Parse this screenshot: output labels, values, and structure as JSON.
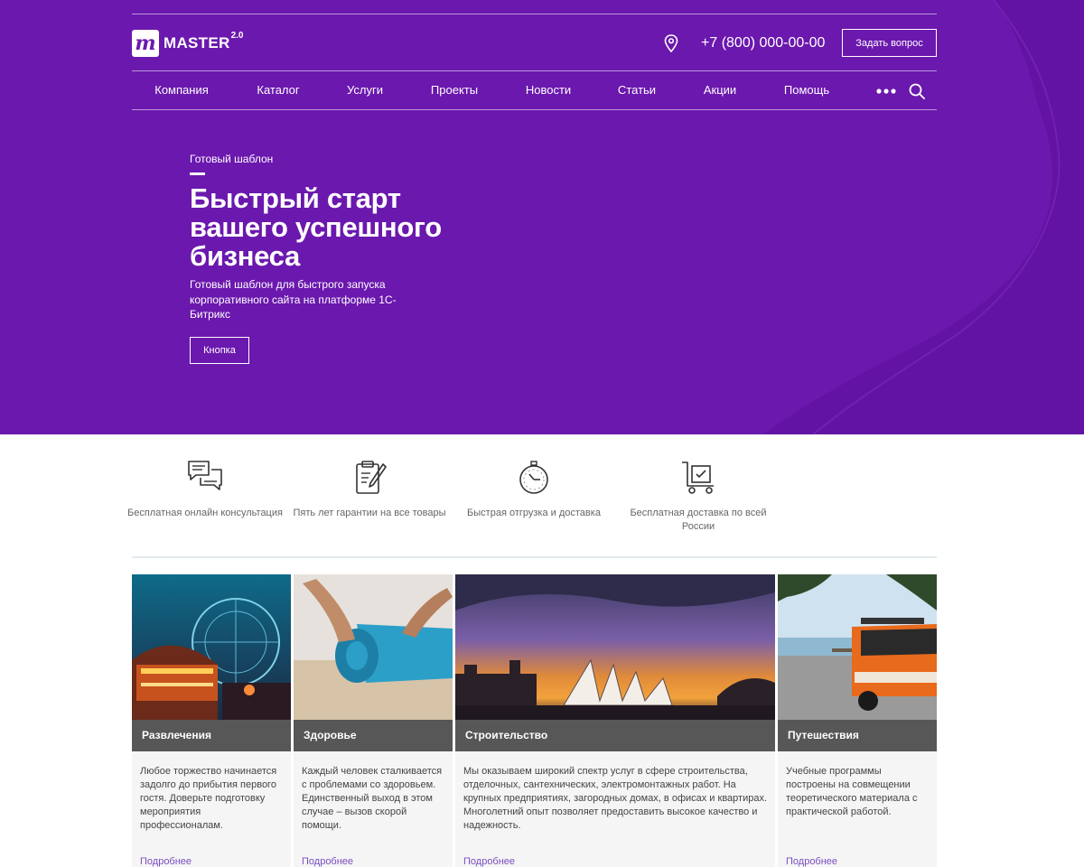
{
  "header": {
    "logo": {
      "mark": "m",
      "name": "MASTER",
      "version": "2.0"
    },
    "phone": "+7 (800) 000-00-00",
    "ask_button": "Задать вопрос",
    "icons": {
      "location": "map-pin-icon",
      "more": "more-dots-icon",
      "search": "search-icon"
    }
  },
  "nav": {
    "items": [
      "Компания",
      "Каталог",
      "Услуги",
      "Проекты",
      "Новости",
      "Статьи",
      "Акции",
      "Помощь"
    ]
  },
  "hero": {
    "eyebrow": "Готовый шаблон",
    "title": "Быстрый старт вашего успешного бизнеса",
    "description": "Готовый шаблон для быстрого запуска корпоративного сайта на платформе 1С-Битрикс",
    "button": "Кнопка"
  },
  "features": [
    {
      "icon": "chat-bubbles-icon",
      "text": "Бесплатная онлайн консультация"
    },
    {
      "icon": "clipboard-pen-icon",
      "text": "Пять лет гарантии на все товары"
    },
    {
      "icon": "stopwatch-icon",
      "text": "Быстрая отгрузка и доставка"
    },
    {
      "icon": "delivery-cart-icon",
      "text": "Бесплатная доставка по всей России"
    }
  ],
  "cards": [
    {
      "title": "Развлечения",
      "image": "amusement-park-photo",
      "text": "Любое торжество начинается задолго до прибытия первого гостя. Доверьте подготовку мероприятия профессионалам.",
      "more": "Подробнее"
    },
    {
      "title": "Здоровье",
      "image": "yoga-mat-photo",
      "text": "Каждый человек сталкивается с проблемами со здоровьем. Единственный выход в этом случае – вызов скорой помощи.",
      "more": "Подробнее"
    },
    {
      "title": "Строительство",
      "image": "opera-house-sunset-photo",
      "text": "Мы оказываем широкий спектр услуг в сфере строительства, отделочных, сантехнических, электромонтажных работ. На крупных предприятиях, загородных домах, в офисах и квартирах. Многолетний опыт позволяет предоставить высокое качество и надежность.",
      "more": "Подробнее"
    },
    {
      "title": "Путешествия",
      "image": "camper-van-beach-photo",
      "text": "Учебные программы построены на совмещении теоретического материала с практической работой.",
      "more": "Подробнее"
    }
  ],
  "colors": {
    "brand": "#6b18ae",
    "card_band": "#575757",
    "link": "#7a4ec0"
  }
}
